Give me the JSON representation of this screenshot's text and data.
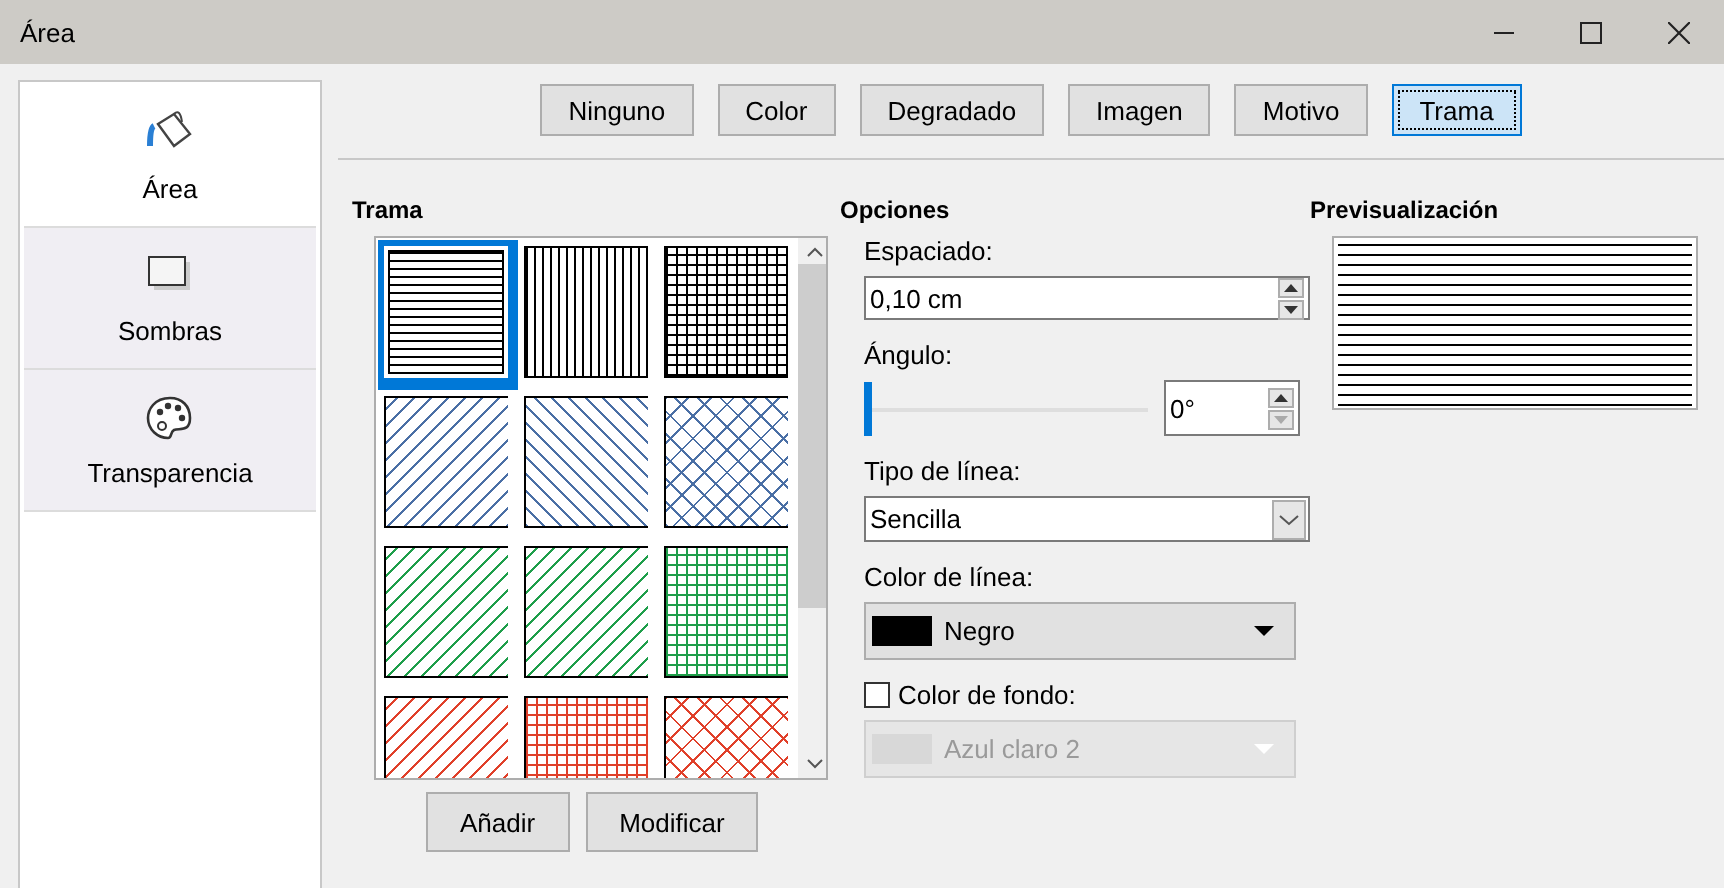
{
  "window": {
    "title": "Área"
  },
  "sidebar": {
    "items": [
      {
        "label": "Área",
        "selected": true
      },
      {
        "label": "Sombras",
        "selected": false
      },
      {
        "label": "Transparencia",
        "selected": false
      }
    ]
  },
  "fill_types": [
    {
      "label": "Ninguno",
      "selected": false
    },
    {
      "label": "Color",
      "selected": false
    },
    {
      "label": "Degradado",
      "selected": false
    },
    {
      "label": "Imagen",
      "selected": false
    },
    {
      "label": "Motivo",
      "selected": false
    },
    {
      "label": "Trama",
      "selected": true
    }
  ],
  "hatch_list": {
    "title": "Trama",
    "swatches": [
      {
        "kind": "horizontal",
        "color": "#000000",
        "selected": true
      },
      {
        "kind": "vertical",
        "color": "#000000",
        "selected": false
      },
      {
        "kind": "grid",
        "color": "#000000",
        "selected": false
      },
      {
        "kind": "diag-up",
        "color": "#4a6fa5",
        "selected": false
      },
      {
        "kind": "diag-down",
        "color": "#4a6fa5",
        "selected": false
      },
      {
        "kind": "crosshatch",
        "color": "#4a6fa5",
        "selected": false
      },
      {
        "kind": "diag-up",
        "color": "#1e9e4a",
        "selected": false
      },
      {
        "kind": "diag-up",
        "color": "#1e9e4a",
        "selected": false
      },
      {
        "kind": "grid",
        "color": "#1e9e4a",
        "selected": false
      },
      {
        "kind": "diag-up",
        "color": "#e0402a",
        "selected": false
      },
      {
        "kind": "grid",
        "color": "#e0402a",
        "selected": false
      },
      {
        "kind": "crosshatch",
        "color": "#e0402a",
        "selected": false
      }
    ],
    "buttons": [
      "Añadir",
      "Modificar"
    ]
  },
  "options": {
    "title": "Opciones",
    "spacing": {
      "label": "Espaciado:",
      "value": "0,10 cm"
    },
    "angle": {
      "label": "Ángulo:",
      "level": 0,
      "value": "0°"
    },
    "line_type": {
      "label": "Tipo de línea:",
      "value": "Sencilla"
    },
    "line_color": {
      "label": "Color de línea:",
      "value": "Negro",
      "color": "#000000"
    },
    "background_color": {
      "label": "Color de fondo:",
      "checked": false,
      "value": "Azul claro 2",
      "disabled": true
    }
  },
  "preview": {
    "title": "Previsualización"
  }
}
